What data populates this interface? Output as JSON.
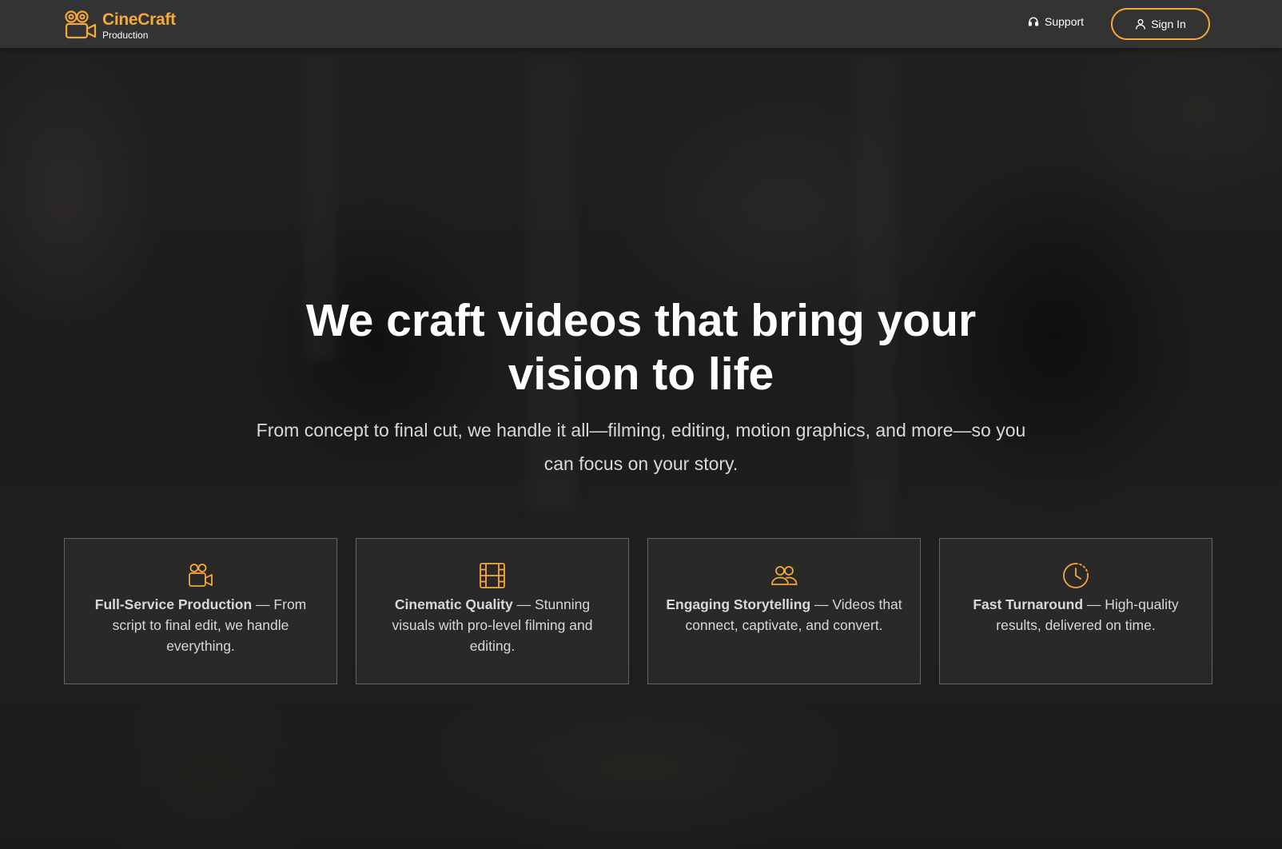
{
  "colors": {
    "accent": "#f5a93b",
    "header_bg": "#333333",
    "text_primary": "#ffffff",
    "text_secondary": "#d9d9d9"
  },
  "header": {
    "brand_name": "CineCraft",
    "brand_sub": "Production",
    "logo_icon": "video-camera-icon",
    "support_label": "Support",
    "support_icon": "headphones-icon",
    "signin_label": "Sign In",
    "signin_icon": "user-icon"
  },
  "hero": {
    "title": "We craft videos that bring your vision to life",
    "subtitle": "From concept to final cut, we handle it all—filming, editing, motion graphics, and more—so you can focus on your story."
  },
  "features": [
    {
      "icon": "video-camera-icon",
      "title": "Full-Service Production",
      "separator": " — ",
      "desc": "From script to final edit, we handle everything."
    },
    {
      "icon": "film-strip-icon",
      "title": "Cinematic Quality",
      "separator": " — ",
      "desc": "Stunning visuals with pro-level filming and editing."
    },
    {
      "icon": "users-icon",
      "title": "Engaging Storytelling",
      "separator": " — ",
      "desc": "Videos that connect, captivate, and convert."
    },
    {
      "icon": "clock-icon",
      "title": "Fast Turnaround",
      "separator": " — ",
      "desc": "High-quality results, delivered on time."
    }
  ]
}
